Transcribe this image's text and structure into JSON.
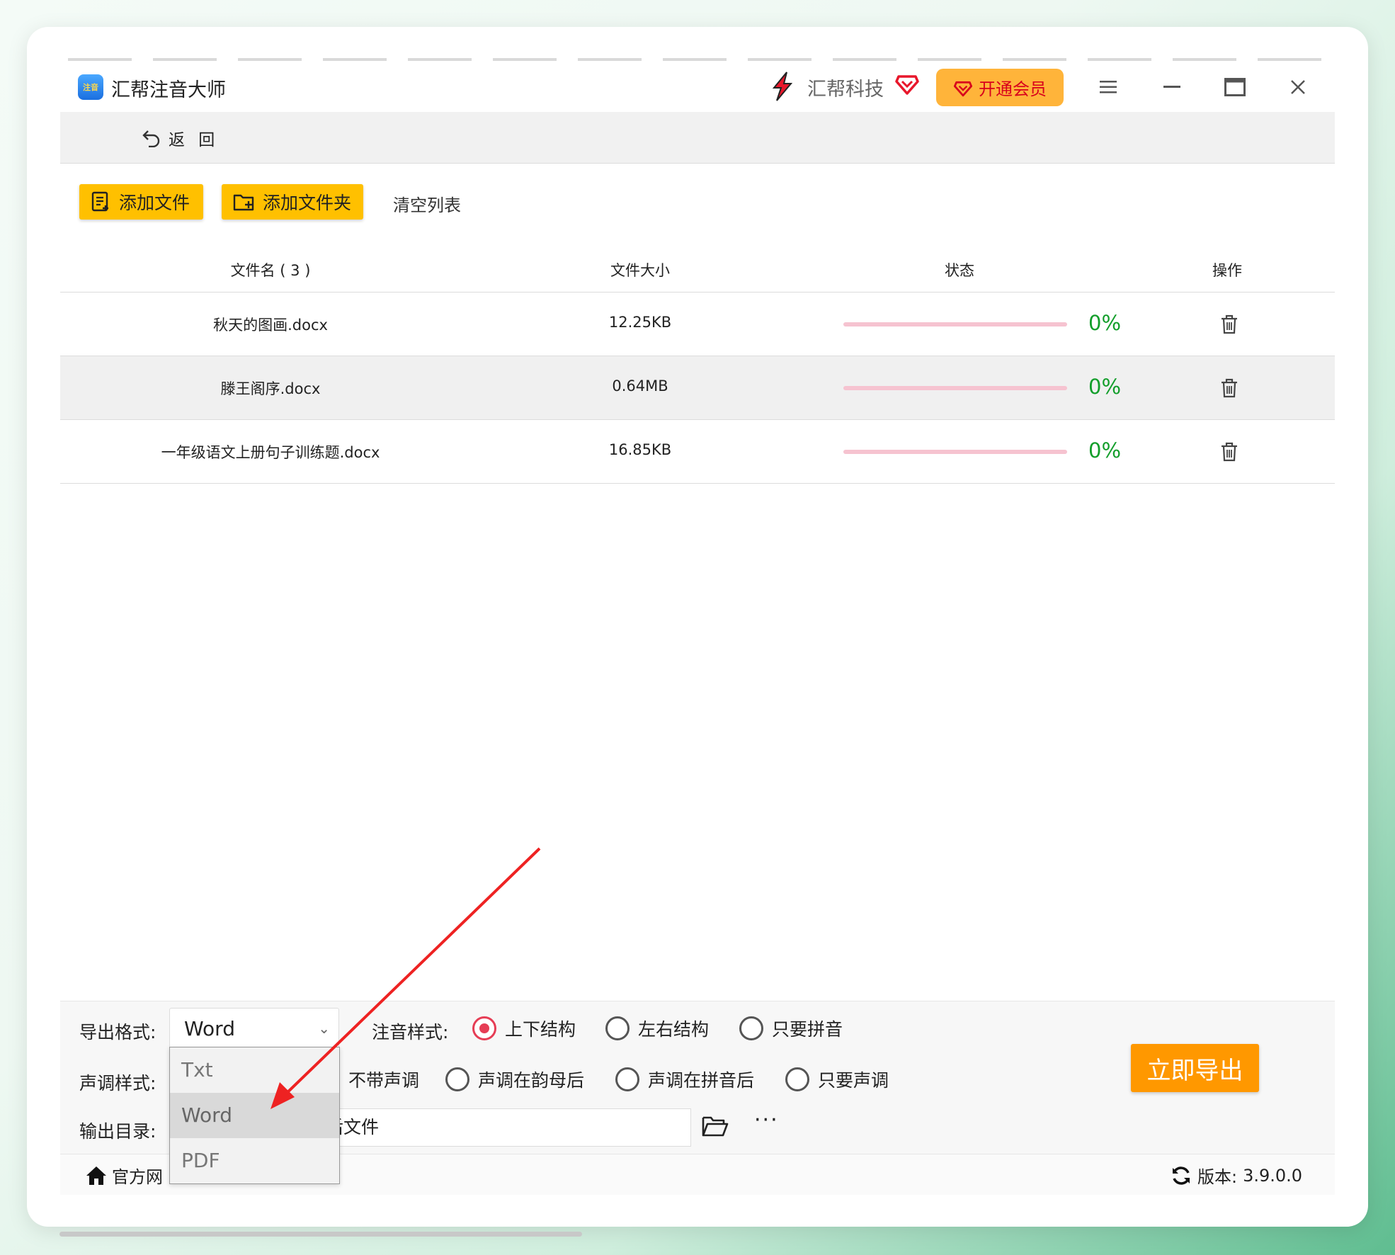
{
  "app": {
    "title": "汇帮注音大师",
    "logo_text": "注音",
    "brand_name": "汇帮科技",
    "vip_label": "开通会员"
  },
  "backbar": {
    "back_label": "返 回"
  },
  "toolbar": {
    "add_file": "添加文件",
    "add_folder": "添加文件夹",
    "clear_list": "清空列表"
  },
  "table": {
    "headers": {
      "name": "文件名 ( 3 )",
      "size": "文件大小",
      "status": "状态",
      "action": "操作"
    },
    "rows": [
      {
        "name": "秋天的图画.docx",
        "size": "12.25KB",
        "progress": 0,
        "progress_label": "0%"
      },
      {
        "name": "滕王阁序.docx",
        "size": "0.64MB",
        "progress": 0,
        "progress_label": "0%"
      },
      {
        "name": "一年级语文上册句子训练题.docx",
        "size": "16.85KB",
        "progress": 0,
        "progress_label": "0%"
      }
    ]
  },
  "options": {
    "format_label": "导出格式:",
    "format_value": "Word",
    "format_choices": [
      "Txt",
      "Word",
      "PDF"
    ],
    "pinyin_style_label": "注音样式:",
    "pinyin_styles": [
      "上下结构",
      "左右结构",
      "只要拼音"
    ],
    "pinyin_style_selected": "上下结构",
    "tone_style_label": "声调样式:",
    "tone_styles_visible": [
      "不带声调",
      "声调在韵母后",
      "声调在拼音后",
      "只要声调"
    ],
    "output_label": "输出目录:",
    "output_value_visible": "后文件",
    "more_label": "···",
    "export_button": "立即导出"
  },
  "footer": {
    "home_label_visible": "官方网",
    "version_label": "版本:",
    "version_value": "3.9.0.0"
  },
  "colors": {
    "accent_yellow": "#ffc000",
    "vip_bg": "#ffb43a",
    "export_orange": "#ff9800",
    "progress_track": "#f6c3d0",
    "percent_green": "#139e2b",
    "radio_on": "#e63d55",
    "arrow_red": "#ee2222"
  }
}
